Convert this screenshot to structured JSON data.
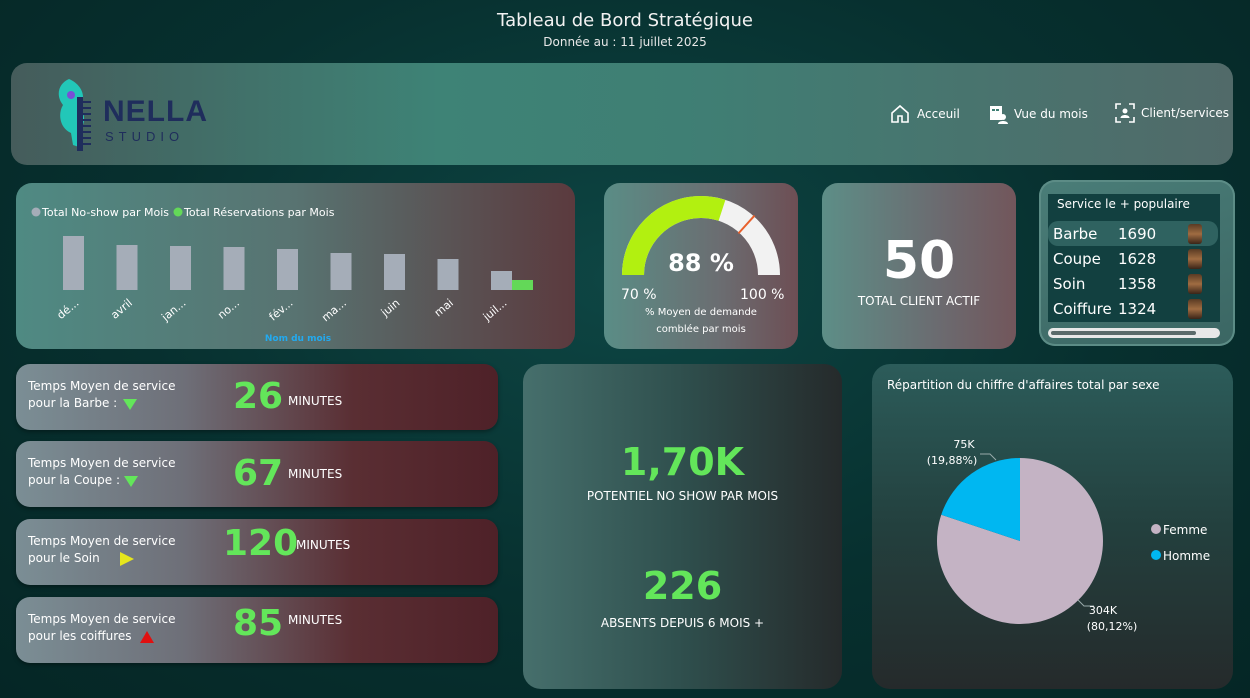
{
  "header": {
    "title": "Tableau de Bord Stratégique",
    "subtitle": "Donnée au : 11 juillet 2025",
    "brand_name": "NELLA",
    "brand_sub": "STUDIO",
    "nav": [
      {
        "label": "Acceuil",
        "icon": "home-icon"
      },
      {
        "label": "Vue du mois",
        "icon": "calendar-person-icon"
      },
      {
        "label": "Client/services",
        "icon": "users-scan-icon"
      }
    ]
  },
  "monthly_chart": {
    "legend_noshow": "Total No-show par Mois",
    "legend_reservations": "Total Réservations par Mois",
    "xlabel": "Nom du mois",
    "colors": {
      "noshow": "#a5adb8",
      "reservations": "#63d858"
    }
  },
  "chart_data": {
    "type": "bar",
    "categories": [
      "dé...",
      "avril",
      "jan...",
      "no...",
      "fév...",
      "ma...",
      "juin",
      "mai",
      "juil..."
    ],
    "series": [
      {
        "name": "Total No-show par Mois",
        "values": [
          54,
          45,
          44,
          43,
          41,
          37,
          36,
          31,
          19
        ]
      },
      {
        "name": "Total Réservations par Mois",
        "values": [
          0,
          0,
          0,
          0,
          0,
          0,
          0,
          0,
          10
        ]
      }
    ],
    "xlabel": "Nom du mois",
    "ylim": [
      0,
      60
    ]
  },
  "gauge": {
    "value_label": "88 %",
    "value": 88,
    "min_label": "70 %",
    "max_label": "100 %",
    "min": 70,
    "max": 100,
    "target": 92,
    "caption_line1": "% Moyen de demande",
    "caption_line2": "comblée par mois",
    "fill_color": "#b2f010",
    "track_color": "#f2f2f2",
    "target_color": "#e8602c"
  },
  "clients": {
    "value": "50",
    "label": "TOTAL CLIENT ACTIF"
  },
  "popular_service": {
    "title": "Service le + populaire",
    "rows": [
      {
        "name": "Barbe",
        "count": "1690"
      },
      {
        "name": "Coupe",
        "count": "1628"
      },
      {
        "name": "Soin",
        "count": "1358"
      },
      {
        "name": "Coiffure",
        "count": "1324"
      }
    ]
  },
  "service_times": [
    {
      "line1": "Temps Moyen de service",
      "line2": "pour la Barbe :",
      "value": "26",
      "unit": "MINUTES",
      "trend": "down",
      "trend_color": "#63e65a"
    },
    {
      "line1": "Temps Moyen de service",
      "line2": "pour la Coupe :",
      "value": "67",
      "unit": "MINUTES",
      "trend": "down",
      "trend_color": "#63e65a"
    },
    {
      "line1": "Temps Moyen de service",
      "line2": "pour le Soin",
      "value": "120",
      "unit": "MINUTES",
      "trend": "flat",
      "trend_color": "#e6e61c"
    },
    {
      "line1": "Temps Moyen de service",
      "line2": "pour les coiffures",
      "value": "85",
      "unit": "MINUTES",
      "trend": "up",
      "trend_color": "#e01010"
    }
  ],
  "potential": {
    "noshow_value": "1,70K",
    "noshow_label": "POTENTIEL NO SHOW PAR MOIS",
    "absent_value": "226",
    "absent_label": "ABSENTS DEPUIS 6 MOIS +"
  },
  "pie": {
    "title": "Répartition du chiffre d'affaires total par sexe",
    "slices": [
      {
        "name": "Femme",
        "value_label": "304K",
        "pct_label": "(80,12%)",
        "pct": 80.12,
        "color": "#c4b3c4"
      },
      {
        "name": "Homme",
        "value_label": "75K",
        "pct_label": "(19,88%)",
        "pct": 19.88,
        "color": "#00b7f1"
      }
    ]
  }
}
